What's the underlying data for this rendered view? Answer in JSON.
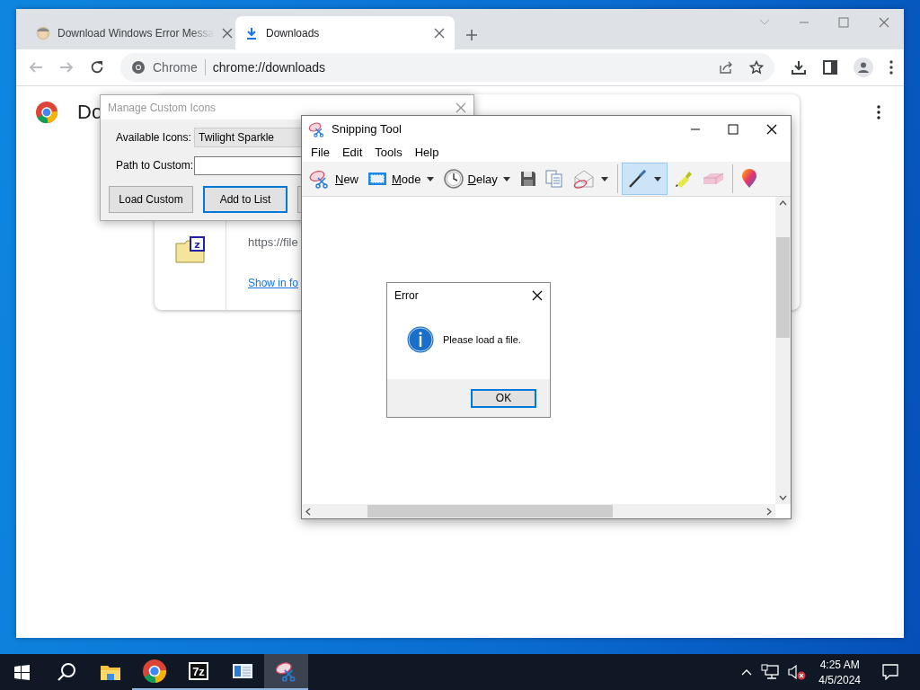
{
  "browser": {
    "tabs": [
      {
        "title": "Download Windows Error Messa",
        "selected": false
      },
      {
        "title": "Downloads",
        "selected": true
      }
    ],
    "toolbar": {
      "back_disabled": true,
      "forward_disabled": true,
      "chip": "Chrome",
      "url": "chrome://downloads"
    },
    "page": {
      "title": "Do",
      "download": {
        "badge": "z",
        "url": "https://file",
        "link": "Show in fo"
      }
    }
  },
  "manage_dialog": {
    "title": "Manage Custom Icons",
    "fields": [
      {
        "kind": "combo",
        "label": "Available Icons:",
        "value": "Twilight Sparkle"
      },
      {
        "kind": "text",
        "label": "Path to Custom:"
      }
    ],
    "buttons": [
      {
        "label": "Load Custom",
        "focused": false
      },
      {
        "label": "Add to List",
        "focused": true
      }
    ]
  },
  "snipping_tool": {
    "title": "Snipping Tool",
    "menu": [
      "File",
      "Edit",
      "Tools",
      "Help"
    ],
    "toolbar": [
      {
        "kind": "new",
        "label": "New",
        "dropdown": false,
        "selected": false
      },
      {
        "kind": "mode",
        "label": "Mode",
        "dropdown": true,
        "selected": false
      },
      {
        "kind": "delay",
        "label": "Delay",
        "dropdown": true,
        "selected": false
      },
      {
        "kind": "save",
        "dropdown": false,
        "selected": false
      },
      {
        "kind": "copy",
        "dropdown": false,
        "selected": false
      },
      {
        "kind": "send",
        "dropdown": true,
        "selected": false
      },
      {
        "kind": "pen",
        "dropdown": true,
        "selected": true
      },
      {
        "kind": "highlighter",
        "dropdown": false,
        "selected": false
      },
      {
        "kind": "eraser",
        "dropdown": false,
        "selected": false
      },
      {
        "kind": "paint",
        "dropdown": false,
        "selected": false
      }
    ]
  },
  "error_dialog": {
    "title": "Error",
    "message": "Please load a file.",
    "button": "OK"
  },
  "taskbar": {
    "apps": [
      {
        "kind": "explorer",
        "running": false,
        "active": false
      },
      {
        "kind": "browser",
        "running": true,
        "active": false
      },
      {
        "kind": "archive",
        "badge": "7z",
        "running": true,
        "active": false
      },
      {
        "kind": "window",
        "running": true,
        "active": false
      },
      {
        "kind": "snipping",
        "running": true,
        "active": true
      }
    ],
    "clock": {
      "time": "4:25 AM",
      "date": "4/5/2024"
    }
  }
}
